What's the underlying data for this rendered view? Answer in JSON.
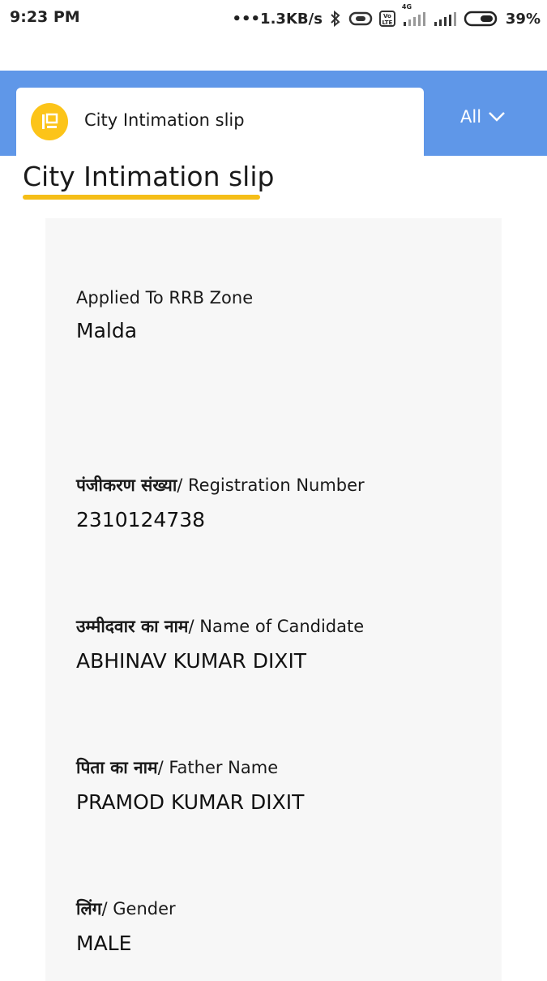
{
  "status_bar": {
    "time": "9:23 PM",
    "speed": "•••1.3KB/s",
    "network_type": "4G",
    "lte_badge": "Vo LTE",
    "battery": "39%",
    "icons": [
      "bluetooth-icon",
      "data-saver-icon",
      "volte-icon",
      "signal-icon",
      "signal-icon",
      "battery-icon"
    ]
  },
  "header": {
    "tab_label": "City Intimation slip",
    "tab_icon": "document-icon",
    "dropdown_label": "All",
    "dropdown_icon": "chevron-down-icon",
    "band_color": "#5f97e8",
    "icon_color": "#fcc419"
  },
  "page": {
    "title": "City Intimation slip",
    "underline_color": "#f5be18"
  },
  "fields": [
    {
      "label_hi": "",
      "label_en": "Applied To RRB Zone",
      "value": "Malda"
    },
    {
      "label_hi": "पंजीकरण संख्या",
      "label_en": "/ Registration Number",
      "value": "2310124738"
    },
    {
      "label_hi": "उम्मीदवार का नाम",
      "label_en": "/ Name of Candidate",
      "value": "ABHINAV KUMAR DIXIT"
    },
    {
      "label_hi": "पिता का नाम",
      "label_en": "/ Father Name",
      "value": "PRAMOD KUMAR DIXIT"
    },
    {
      "label_hi": "लिंग",
      "label_en": "/ Gender",
      "value": "MALE"
    }
  ]
}
